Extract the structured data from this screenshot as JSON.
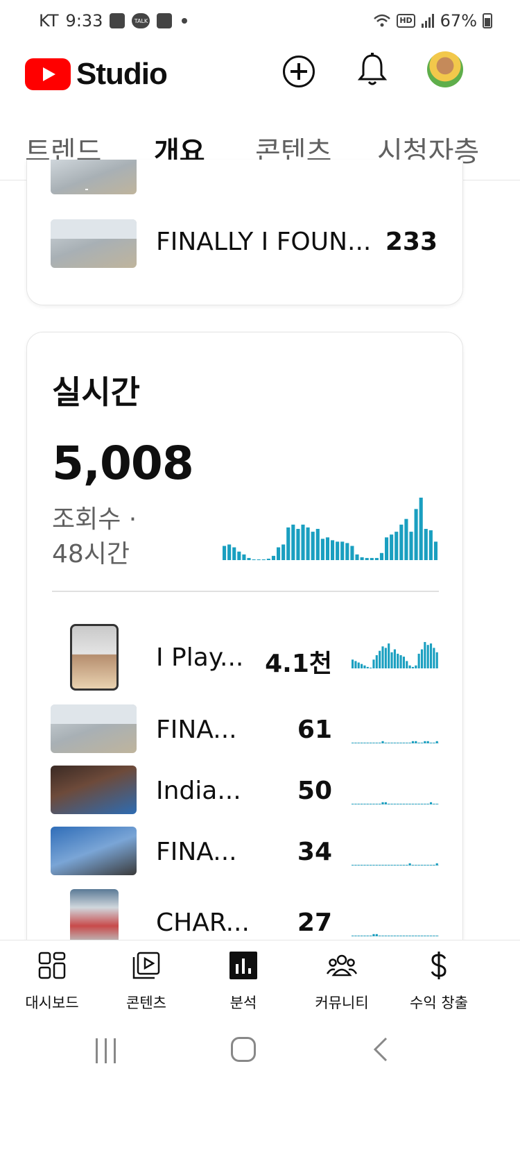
{
  "status_bar": {
    "carrier": "KT",
    "time": "9:33",
    "talk_badge": "TALK",
    "hd_label": "HD",
    "battery": "67%"
  },
  "app_bar": {
    "logo_text": "Studio"
  },
  "tabs": [
    {
      "label": "트렌드",
      "active": false
    },
    {
      "label": "개요",
      "active": true
    },
    {
      "label": "콘텐츠",
      "active": false
    },
    {
      "label": "시청자층",
      "active": false
    }
  ],
  "top_card": {
    "rows": [
      {
        "title": "FINALLY I FOUN...",
        "value": "233"
      }
    ]
  },
  "realtime": {
    "title": "실시간",
    "views": "5,008",
    "subtitle_line1": "조회수 ·",
    "subtitle_line2": "48시간",
    "colors": {
      "bar": "#1a9fc0"
    },
    "videos": [
      {
        "title": "I Play...",
        "value": "4.1천"
      },
      {
        "title": "FINA...",
        "value": "61"
      },
      {
        "title": "India...",
        "value": "50"
      },
      {
        "title": "FINA...",
        "value": "34"
      },
      {
        "title": "CHAR...",
        "value": "27"
      }
    ]
  },
  "chart_data": [
    {
      "type": "bar",
      "name": "realtime-48h",
      "values": [
        20,
        22,
        18,
        12,
        8,
        3,
        1,
        1,
        1,
        2,
        6,
        18,
        22,
        46,
        50,
        44,
        50,
        46,
        40,
        44,
        30,
        32,
        28,
        26,
        26,
        24,
        20,
        8,
        4,
        3,
        3,
        3,
        10,
        32,
        36,
        40,
        50,
        58,
        40,
        72,
        88,
        44,
        42,
        26
      ]
    },
    {
      "type": "bar",
      "name": "video-1",
      "values": [
        12,
        10,
        8,
        6,
        4,
        2,
        1,
        12,
        18,
        24,
        30,
        28,
        34,
        22,
        26,
        20,
        18,
        16,
        10,
        4,
        2,
        4,
        20,
        26,
        36,
        32,
        34,
        28,
        22
      ]
    },
    {
      "type": "line",
      "name": "video-2",
      "values": [
        0,
        0,
        0,
        0,
        0,
        0,
        0,
        0,
        0,
        0,
        1,
        0,
        0,
        0,
        0,
        0,
        0,
        0,
        0,
        0,
        1,
        1,
        0,
        0,
        1,
        1,
        0,
        0,
        1
      ]
    },
    {
      "type": "line",
      "name": "video-3",
      "values": [
        0,
        0,
        0,
        0,
        0,
        0,
        0,
        0,
        0,
        0,
        1,
        1,
        0,
        0,
        0,
        0,
        0,
        0,
        0,
        0,
        0,
        0,
        0,
        0,
        0,
        0,
        1,
        0,
        0
      ]
    },
    {
      "type": "line",
      "name": "video-4",
      "values": [
        0,
        0,
        0,
        0,
        0,
        0,
        0,
        0,
        0,
        0,
        0,
        0,
        0,
        0,
        0,
        0,
        0,
        0,
        0,
        1,
        0,
        0,
        0,
        0,
        0,
        0,
        0,
        0,
        1
      ]
    },
    {
      "type": "line",
      "name": "video-5",
      "values": [
        0,
        0,
        0,
        0,
        0,
        0,
        0,
        1,
        1,
        0,
        0,
        0,
        0,
        0,
        0,
        0,
        0,
        0,
        0,
        0,
        0,
        0,
        0,
        0,
        0,
        0,
        0,
        0,
        0
      ]
    }
  ],
  "bottom_nav": [
    {
      "label": "대시보드",
      "icon": "dashboard-icon"
    },
    {
      "label": "콘텐츠",
      "icon": "content-icon"
    },
    {
      "label": "분석",
      "icon": "analytics-icon",
      "active": true
    },
    {
      "label": "커뮤니티",
      "icon": "community-icon"
    },
    {
      "label": "수익 창출",
      "icon": "dollar-icon"
    }
  ]
}
